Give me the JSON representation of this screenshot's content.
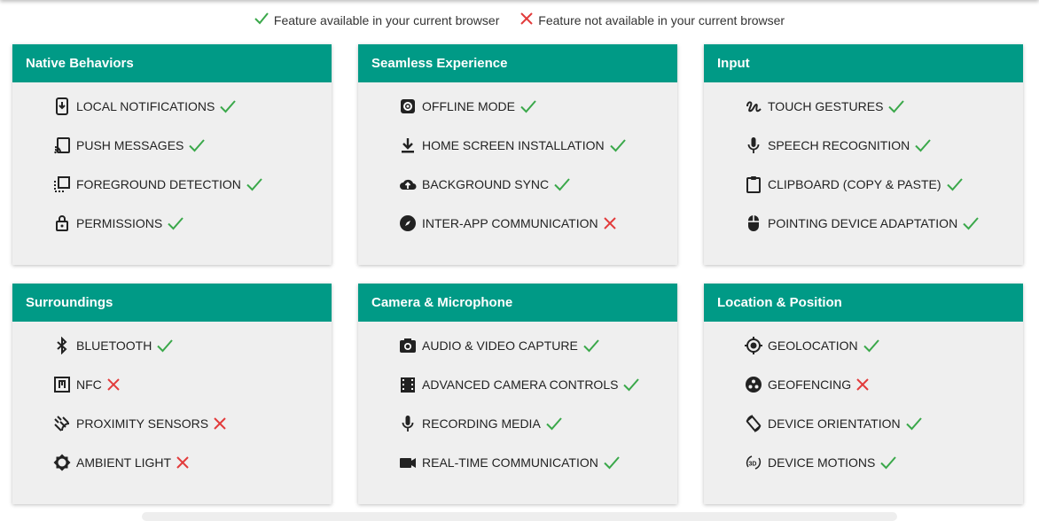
{
  "legend": {
    "available": "Feature available in your current browser",
    "unavailable": "Feature not available in your current browser"
  },
  "colors": {
    "accent": "#009a86",
    "yes": "#3aa84a",
    "no": "#e23b3b"
  },
  "cards": [
    {
      "title": "Native Behaviors",
      "features": [
        {
          "label": "LOCAL NOTIFICATIONS",
          "icon": "phone-download-icon",
          "ok": true
        },
        {
          "label": "PUSH MESSAGES",
          "icon": "cast-icon",
          "ok": true
        },
        {
          "label": "FOREGROUND DETECTION",
          "icon": "foreground-icon",
          "ok": true
        },
        {
          "label": "PERMISSIONS",
          "icon": "lock-icon",
          "ok": true
        }
      ]
    },
    {
      "title": "Seamless Experience",
      "features": [
        {
          "label": "OFFLINE MODE",
          "icon": "gear-icon",
          "ok": true
        },
        {
          "label": "HOME SCREEN INSTALLATION",
          "icon": "download-icon",
          "ok": true
        },
        {
          "label": "BACKGROUND SYNC",
          "icon": "cloud-upload-icon",
          "ok": true
        },
        {
          "label": "INTER-APP COMMUNICATION",
          "icon": "compass-icon",
          "ok": false
        }
      ]
    },
    {
      "title": "Input",
      "features": [
        {
          "label": "TOUCH GESTURES",
          "icon": "gesture-icon",
          "ok": true
        },
        {
          "label": "SPEECH RECOGNITION",
          "icon": "microphone-icon",
          "ok": true
        },
        {
          "label": "CLIPBOARD (COPY & PASTE)",
          "icon": "clipboard-icon",
          "ok": true
        },
        {
          "label": "POINTING DEVICE ADAPTATION",
          "icon": "mouse-icon",
          "ok": true
        }
      ]
    },
    {
      "title": "Surroundings",
      "features": [
        {
          "label": "BLUETOOTH",
          "icon": "bluetooth-icon",
          "ok": true
        },
        {
          "label": "NFC",
          "icon": "nfc-icon",
          "ok": false
        },
        {
          "label": "PROXIMITY SENSORS",
          "icon": "proximity-icon",
          "ok": false
        },
        {
          "label": "AMBIENT LIGHT",
          "icon": "brightness-icon",
          "ok": false
        }
      ]
    },
    {
      "title": "Camera & Microphone",
      "features": [
        {
          "label": "AUDIO & VIDEO CAPTURE",
          "icon": "camera-icon",
          "ok": true
        },
        {
          "label": "ADVANCED CAMERA CONTROLS",
          "icon": "film-icon",
          "ok": true
        },
        {
          "label": "RECORDING MEDIA",
          "icon": "microphone-icon",
          "ok": true
        },
        {
          "label": "REAL-TIME COMMUNICATION",
          "icon": "videocam-icon",
          "ok": true
        }
      ]
    },
    {
      "title": "Location & Position",
      "features": [
        {
          "label": "GEOLOCATION",
          "icon": "crosshair-icon",
          "ok": true
        },
        {
          "label": "GEOFENCING",
          "icon": "geofence-icon",
          "ok": false
        },
        {
          "label": "DEVICE ORIENTATION",
          "icon": "rotate-icon",
          "ok": true
        },
        {
          "label": "DEVICE MOTIONS",
          "icon": "3d-rotation-icon",
          "ok": true
        }
      ]
    }
  ]
}
